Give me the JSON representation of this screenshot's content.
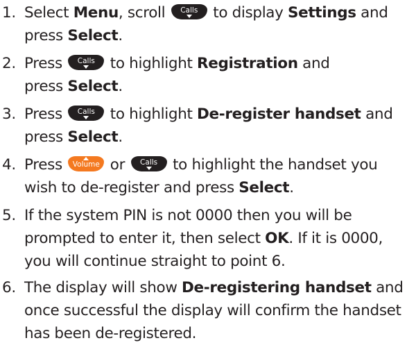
{
  "keys": {
    "calls_label": "Calls",
    "volume_label": "Volume",
    "calls_color": "#231f20",
    "volume_color": "#f47920"
  },
  "steps": [
    {
      "number": "1.",
      "line1": {
        "t1": "Select ",
        "b1": "Menu",
        "t2": ", scroll",
        "t3": " to display ",
        "b2": "Settings",
        "t4": " and"
      },
      "line2": {
        "t1": "press ",
        "b1": "Select",
        "t2": "."
      }
    },
    {
      "number": "2.",
      "line1": {
        "t1": "Press",
        "t2": " to highlight ",
        "b1": "Registration",
        "t3": " and"
      },
      "line2": {
        "t1": "press ",
        "b1": "Select",
        "t2": "."
      }
    },
    {
      "number": "3.",
      "line1": {
        "t1": "Press",
        "t2": " to highlight ",
        "b1": "De-register handset",
        "t3": " and"
      },
      "line2": {
        "t1": "press ",
        "b1": "Select",
        "t2": "."
      }
    },
    {
      "number": "4.",
      "line1": {
        "t1": "Press",
        "t2": " or",
        "t3": " to highlight the handset you"
      },
      "line2": {
        "t1": "wish to de-register and press ",
        "b1": "Select",
        "t2": "."
      }
    },
    {
      "number": "5.",
      "line1": {
        "t1": "If the system PIN is not 0000 then you will be"
      },
      "line2": {
        "t1": "prompted to enter it, then select ",
        "b1": "OK",
        "t2": ". If it is 0000,"
      },
      "line3": {
        "t1": "you will continue straight to point 6."
      }
    },
    {
      "number": "6.",
      "line1": {
        "t1": "The display will show ",
        "b1": "De-registering handset",
        "t2": " and"
      },
      "line2": {
        "t1": "once successful the display will confirm the handset"
      },
      "line3": {
        "t1": "has been de-registered."
      }
    }
  ]
}
